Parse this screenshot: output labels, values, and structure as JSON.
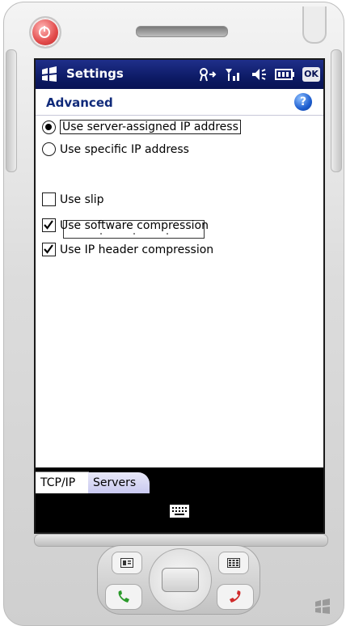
{
  "title_bar": {
    "app_title": "Settings",
    "ok_label": "OK"
  },
  "page": {
    "title": "Advanced"
  },
  "options": {
    "server_ip": {
      "label": "Use server-assigned IP address",
      "selected": true
    },
    "specific_ip": {
      "label": "Use specific IP address",
      "selected": false
    },
    "use_slip": {
      "label": "Use slip",
      "checked": false
    },
    "software_compression": {
      "label": "Use software compression",
      "checked": true
    },
    "ip_header_compression": {
      "label": "Use IP header compression",
      "checked": true
    }
  },
  "tabs": [
    {
      "label": "TCP/IP",
      "active": true
    },
    {
      "label": "Servers",
      "active": false
    }
  ],
  "colors": {
    "title_bar": "#0d1b66",
    "page_title": "#102a7a",
    "tab_servers": "#c9c9f0"
  },
  "icons": [
    "power-icon",
    "start-icon",
    "connectivity-icon",
    "signal-icon",
    "volume-icon",
    "battery-icon",
    "help-icon",
    "keyboard-icon",
    "windows-logo-icon"
  ]
}
